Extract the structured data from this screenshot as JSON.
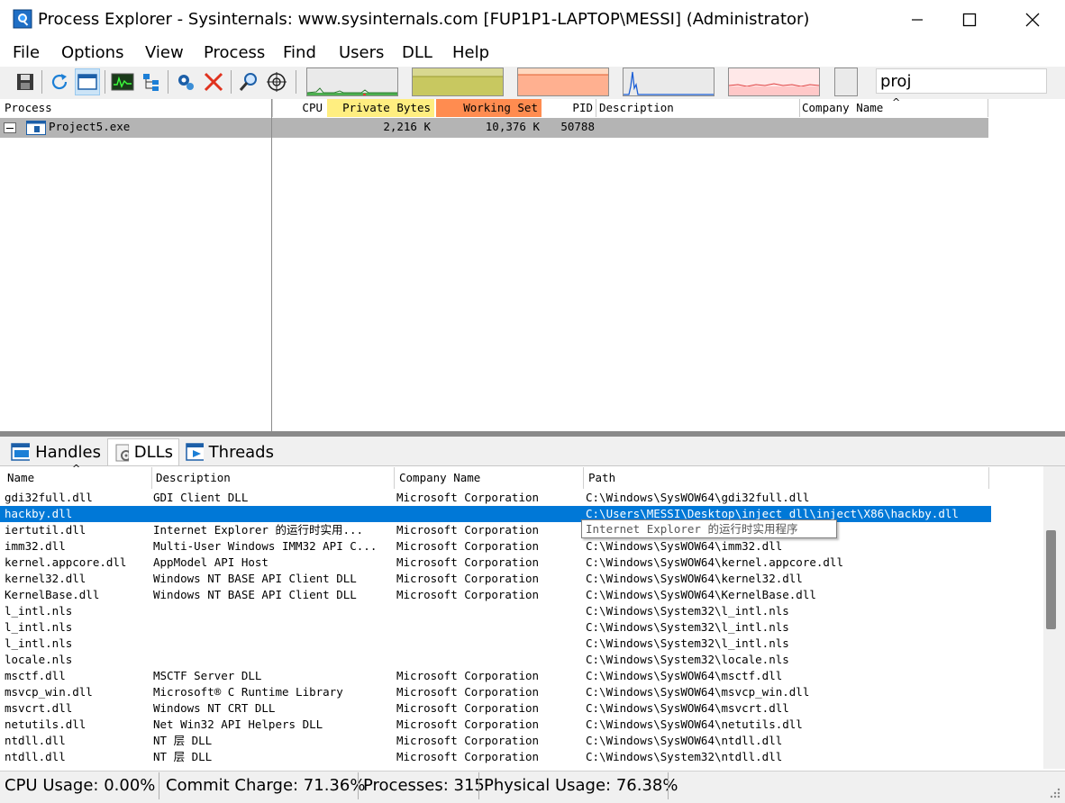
{
  "window": {
    "title": "Process Explorer - Sysinternals: www.sysinternals.com [FUP1P1-LAPTOP\\MESSI] (Administrator)"
  },
  "menu": [
    {
      "label": "File"
    },
    {
      "label": "Options"
    },
    {
      "label": "View"
    },
    {
      "label": "Process"
    },
    {
      "label": "Find"
    },
    {
      "label": "Users"
    },
    {
      "label": "DLL"
    },
    {
      "label": "Help"
    }
  ],
  "toolbar": {
    "icons": [
      "save-icon",
      "refresh-icon",
      "window-icon",
      "system-info-icon",
      "tree-icon",
      "properties-icon",
      "kill-icon",
      "find-icon",
      "target-icon"
    ],
    "search_value": "proj"
  },
  "process_table": {
    "columns": [
      "Process",
      "CPU",
      "Private Bytes",
      "Working Set",
      "PID",
      "Description",
      "Company Name"
    ],
    "header_colors": {
      "private_bytes": "#ffee80",
      "working_set": "#ff8c50"
    },
    "rows": [
      {
        "process": "Project5.exe",
        "cpu": "",
        "private_bytes": "2,216 K",
        "working_set": "10,376 K",
        "pid": "50788",
        "description": "",
        "company": ""
      }
    ]
  },
  "tabs": [
    {
      "label": "Handles",
      "icon": "handles-icon"
    },
    {
      "label": "DLLs",
      "icon": "dll-icon"
    },
    {
      "label": "Threads",
      "icon": "threads-icon"
    }
  ],
  "dll_table": {
    "columns": [
      "Name",
      "Description",
      "Company Name",
      "Path"
    ],
    "tooltip": "Internet Explorer 的运行时实用程序",
    "selected_color": "#0078d7",
    "rows": [
      {
        "name": "gdi32full.dll",
        "description": "GDI Client DLL",
        "company": "Microsoft Corporation",
        "path": "C:\\Windows\\SysWOW64\\gdi32full.dll"
      },
      {
        "name": "hackby.dll",
        "description": "",
        "company": "",
        "path": "C:\\Users\\MESSI\\Desktop\\inject dll\\inject\\X86\\hackby.dll"
      },
      {
        "name": "iertutil.dll",
        "description": "Internet Explorer 的运行时实用...",
        "company": "Microsoft Corporation",
        "path": ""
      },
      {
        "name": "imm32.dll",
        "description": "Multi-User Windows IMM32 API C...",
        "company": "Microsoft Corporation",
        "path": "C:\\Windows\\SysWOW64\\imm32.dll"
      },
      {
        "name": "kernel.appcore.dll",
        "description": "AppModel API Host",
        "company": "Microsoft Corporation",
        "path": "C:\\Windows\\SysWOW64\\kernel.appcore.dll"
      },
      {
        "name": "kernel32.dll",
        "description": "Windows NT BASE API Client DLL",
        "company": "Microsoft Corporation",
        "path": "C:\\Windows\\SysWOW64\\kernel32.dll"
      },
      {
        "name": "KernelBase.dll",
        "description": "Windows NT BASE API Client DLL",
        "company": "Microsoft Corporation",
        "path": "C:\\Windows\\SysWOW64\\KernelBase.dll"
      },
      {
        "name": "l_intl.nls",
        "description": "",
        "company": "",
        "path": "C:\\Windows\\System32\\l_intl.nls"
      },
      {
        "name": "l_intl.nls",
        "description": "",
        "company": "",
        "path": "C:\\Windows\\System32\\l_intl.nls"
      },
      {
        "name": "l_intl.nls",
        "description": "",
        "company": "",
        "path": "C:\\Windows\\System32\\l_intl.nls"
      },
      {
        "name": "locale.nls",
        "description": "",
        "company": "",
        "path": "C:\\Windows\\System32\\locale.nls"
      },
      {
        "name": "msctf.dll",
        "description": "MSCTF Server DLL",
        "company": "Microsoft Corporation",
        "path": "C:\\Windows\\SysWOW64\\msctf.dll"
      },
      {
        "name": "msvcp_win.dll",
        "description": "Microsoft® C Runtime Library",
        "company": "Microsoft Corporation",
        "path": "C:\\Windows\\SysWOW64\\msvcp_win.dll"
      },
      {
        "name": "msvcrt.dll",
        "description": "Windows NT CRT DLL",
        "company": "Microsoft Corporation",
        "path": "C:\\Windows\\SysWOW64\\msvcrt.dll"
      },
      {
        "name": "netutils.dll",
        "description": "Net Win32 API Helpers DLL",
        "company": "Microsoft Corporation",
        "path": "C:\\Windows\\SysWOW64\\netutils.dll"
      },
      {
        "name": "ntdll.dll",
        "description": "NT 层 DLL",
        "company": "Microsoft Corporation",
        "path": "C:\\Windows\\SysWOW64\\ntdll.dll"
      },
      {
        "name": "ntdll.dll",
        "description": "NT 层 DLL",
        "company": "Microsoft Corporation",
        "path": "C:\\Windows\\System32\\ntdll.dll"
      }
    ]
  },
  "status": {
    "cpu": "CPU Usage: 0.00%",
    "commit": "Commit Charge: 71.36%",
    "processes": "Processes: 315",
    "physical": "Physical Usage: 76.38%"
  }
}
